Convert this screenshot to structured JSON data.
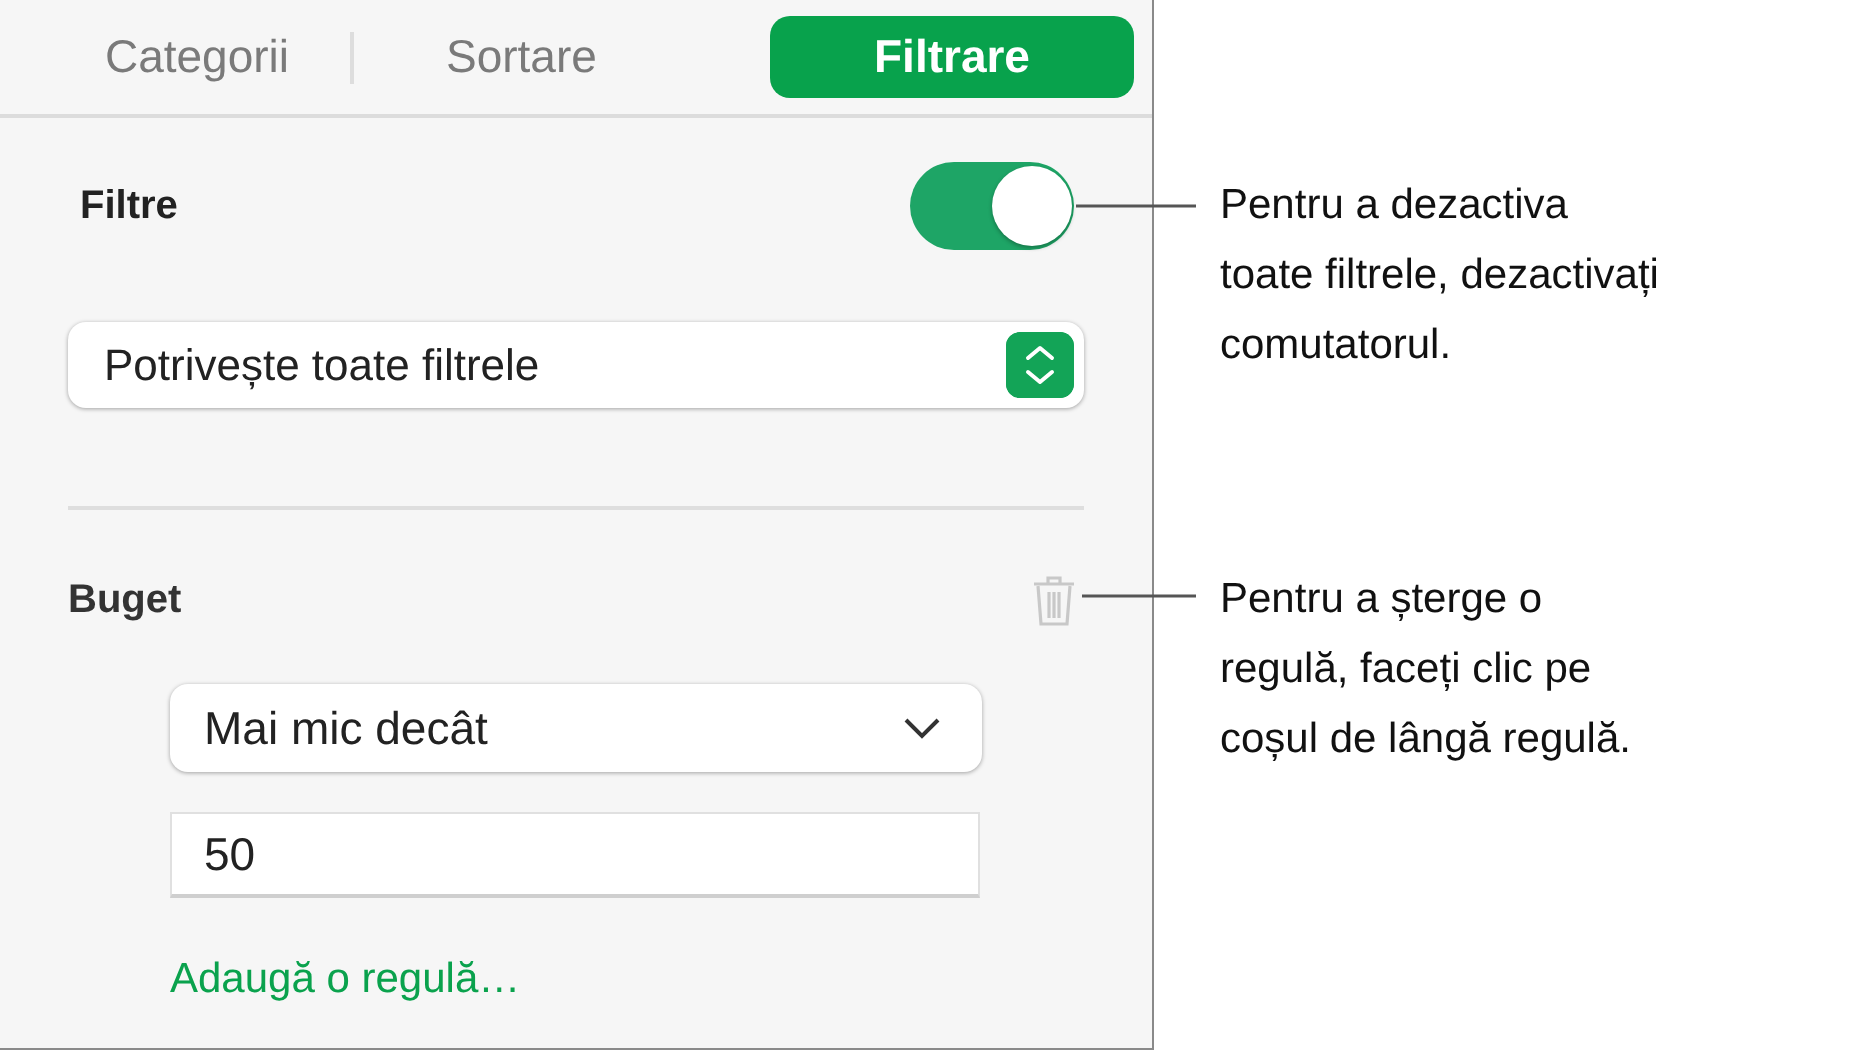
{
  "tabs": [
    {
      "label": "Categorii",
      "selected": false
    },
    {
      "label": "Sortare",
      "selected": false
    },
    {
      "label": "Filtrare",
      "selected": true
    }
  ],
  "filters": {
    "label": "Filtre",
    "on": true
  },
  "match_popup": {
    "value": "Potrivește toate filtrele"
  },
  "rule": {
    "label": "Buget",
    "condition": "Mai mic decât",
    "value": "50"
  },
  "add_rule_link": "Adaugă o regulă…",
  "callouts": [
    {
      "lines": [
        "Pentru a dezactiva",
        "toate filtrele, dezactivați",
        "comutatorul."
      ]
    },
    {
      "lines": [
        "Pentru a șterge o",
        "regulă, faceți clic pe",
        "coșul de lângă regulă."
      ]
    }
  ]
}
